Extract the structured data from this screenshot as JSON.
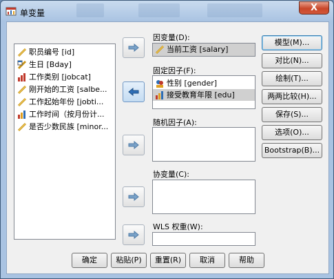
{
  "window": {
    "title": "单变量",
    "close_label": "X"
  },
  "variables": [
    {
      "label": "职员编号 [id]",
      "icon": "ruler-icon"
    },
    {
      "label": "生日 [Bday]",
      "icon": "date-icon"
    },
    {
      "label": "工作类别 [jobcat]",
      "icon": "bar-icon"
    },
    {
      "label": "刚开始的工资 [salbe...",
      "icon": "ruler-icon"
    },
    {
      "label": "工作起始年份 [jobti...",
      "icon": "ruler-icon"
    },
    {
      "label": "工作时间（按月份计...",
      "icon": "bar-icon"
    },
    {
      "label": "是否少数民族 [minor...",
      "icon": "ruler-icon"
    }
  ],
  "fields": {
    "dependent": {
      "label": "因变量(D):",
      "value": "当前工资 [salary]"
    },
    "fixed": {
      "label": "固定因子(F):",
      "items": [
        "性别 [gender]",
        "接受教育年限 [edu]"
      ]
    },
    "random": {
      "label": "随机因子(A):"
    },
    "covariate": {
      "label": "协变量(C):"
    },
    "wls": {
      "label": "WLS 权重(W):"
    }
  },
  "side_buttons": [
    "模型(M)...",
    "对比(N)...",
    "绘制(T)...",
    "两两比较(H)...",
    "保存(S)...",
    "选项(O)...",
    "Bootstrap(B)..."
  ],
  "bottom_buttons": [
    "确定",
    "粘贴(P)",
    "重置(R)",
    "取消",
    "帮助"
  ]
}
